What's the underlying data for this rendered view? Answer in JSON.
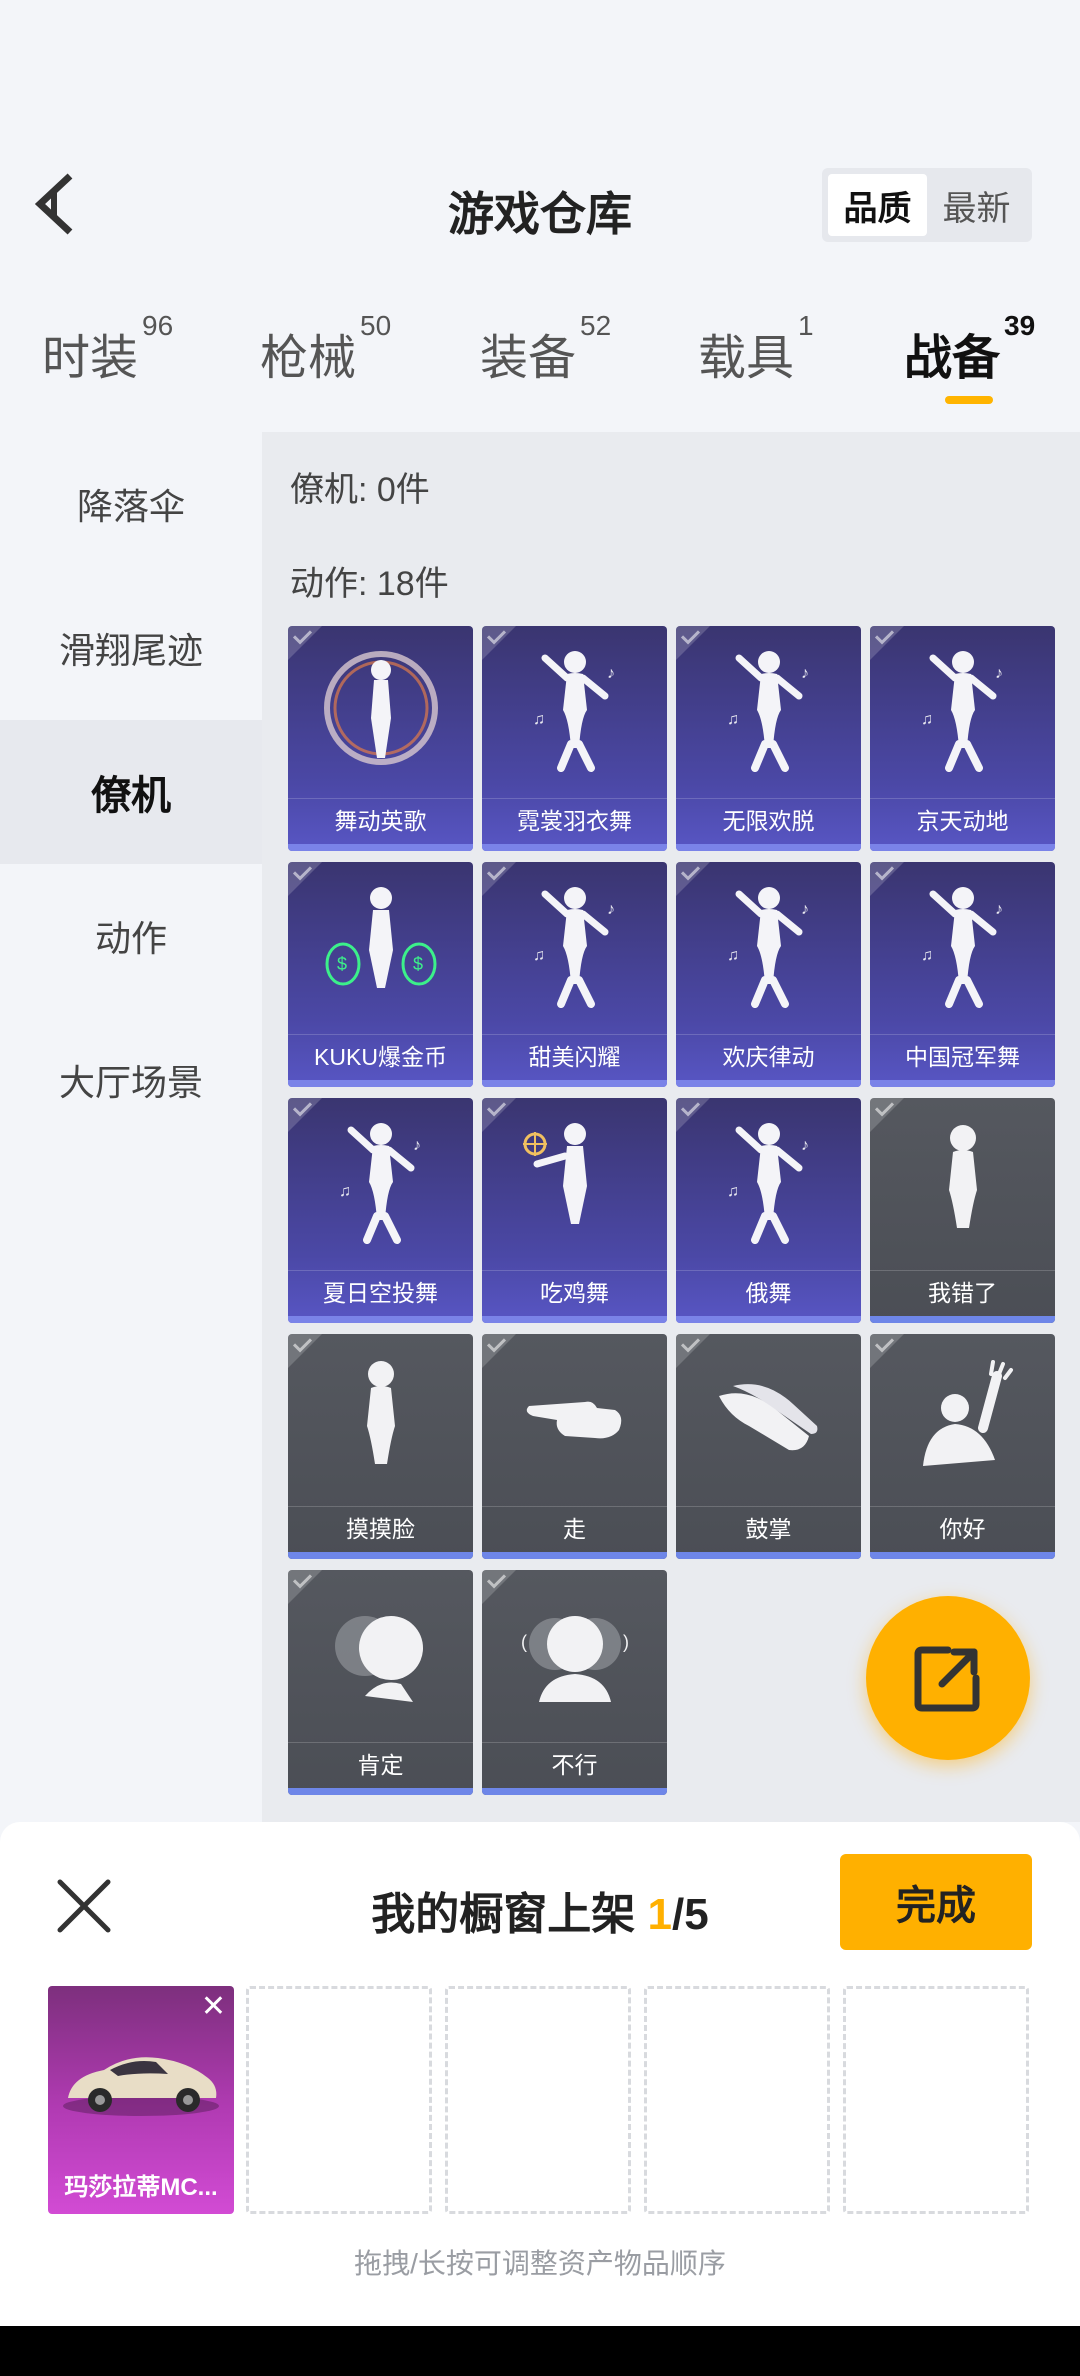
{
  "header": {
    "title": "游戏仓库",
    "sort_options": [
      {
        "label": "品质",
        "active": true
      },
      {
        "label": "最新",
        "active": false
      }
    ]
  },
  "tabs": [
    {
      "label": "时装",
      "count": "96"
    },
    {
      "label": "枪械",
      "count": "50"
    },
    {
      "label": "装备",
      "count": "52"
    },
    {
      "label": "载具",
      "count": "1"
    },
    {
      "label": "战备",
      "count": "39"
    }
  ],
  "sidebar": {
    "items": [
      {
        "label": "降落伞"
      },
      {
        "label": "滑翔尾迹"
      },
      {
        "label": "僚机"
      },
      {
        "label": "动作"
      },
      {
        "label": "大厅场景"
      }
    ]
  },
  "content": {
    "wingman_count": "僚机: 0件",
    "emote_count": "动作: 18件",
    "items": [
      {
        "name": "舞动英歌",
        "style": "purple",
        "icon": "dancer-bubble-icon"
      },
      {
        "name": "霓裳羽衣舞",
        "style": "purple",
        "icon": "dancer-icon"
      },
      {
        "name": "无限欢脱",
        "style": "purple",
        "icon": "dancer-icon"
      },
      {
        "name": "京天动地",
        "style": "purple",
        "icon": "dancer-icon"
      },
      {
        "name": "KUKU爆金币",
        "style": "purple",
        "icon": "money-bag-dancer-icon"
      },
      {
        "name": "甜美闪耀",
        "style": "purple",
        "icon": "dancer-icon"
      },
      {
        "name": "欢庆律动",
        "style": "purple",
        "icon": "dancer-icon"
      },
      {
        "name": "中国冠军舞",
        "style": "purple",
        "icon": "dancer-icon"
      },
      {
        "name": "夏日空投舞",
        "style": "purple",
        "icon": "dancer-icon"
      },
      {
        "name": "吃鸡舞",
        "style": "purple",
        "icon": "dancer-target-icon"
      },
      {
        "name": "俄舞",
        "style": "purple",
        "icon": "dancer-icon"
      },
      {
        "name": "我错了",
        "style": "gray",
        "icon": "figure-icon"
      },
      {
        "name": "摸摸脸",
        "style": "gray",
        "icon": "figure-icon"
      },
      {
        "name": "走",
        "style": "gray",
        "icon": "pointing-hand-icon"
      },
      {
        "name": "鼓掌",
        "style": "gray",
        "icon": "clapping-hands-icon"
      },
      {
        "name": "你好",
        "style": "gray",
        "icon": "waving-figure-icon"
      },
      {
        "name": "肯定",
        "style": "gray",
        "icon": "nodding-head-icon"
      },
      {
        "name": "不行",
        "style": "gray",
        "icon": "shaking-head-icon"
      }
    ]
  },
  "bottom_panel": {
    "title_prefix": "我的橱窗上架 ",
    "filled_count": "1",
    "total_suffix": "/5",
    "done_label": "完成",
    "slots": [
      {
        "filled": true,
        "name": "玛莎拉蒂MC...",
        "icon": "sports-car-icon"
      },
      {
        "filled": false
      },
      {
        "filled": false
      },
      {
        "filled": false
      },
      {
        "filled": false
      }
    ],
    "hint": "拖拽/长按可调整资产物品顺序"
  },
  "colors": {
    "accent": "#ffb000",
    "purple_card": "#4b48a6",
    "gray_card": "#4b4e55",
    "slot_magenta": "#b23bb4"
  }
}
